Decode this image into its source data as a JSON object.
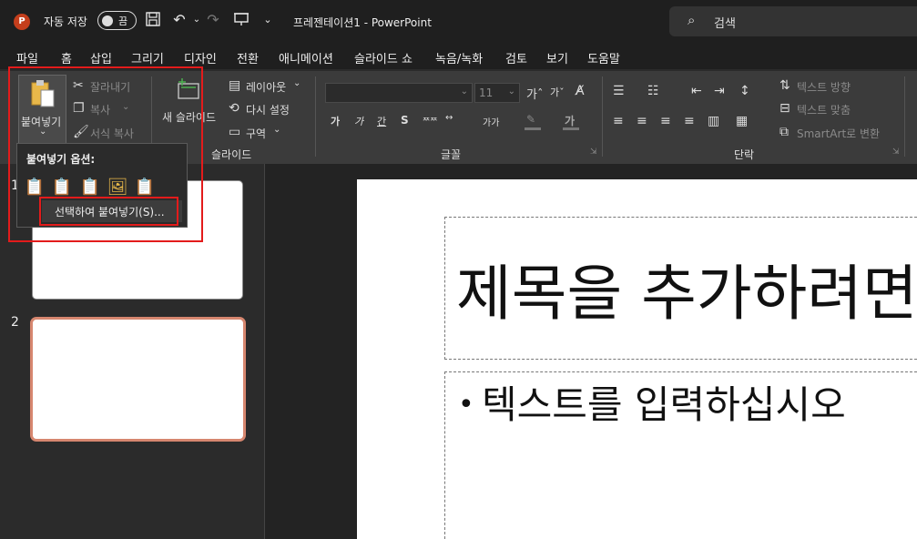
{
  "titlebar": {
    "app_logo": "P",
    "autosave_label": "자동 저장",
    "autosave_state": "끔",
    "doc_title": "프레젠테이션1 - PowerPoint",
    "search_placeholder": "검색",
    "icons": [
      "save-icon",
      "undo-icon",
      "redo-icon",
      "present-icon",
      "customize-qat-icon"
    ]
  },
  "menu": {
    "tabs": [
      "파일",
      "홈",
      "삽입",
      "그리기",
      "디자인",
      "전환",
      "애니메이션",
      "슬라이드 쇼",
      "녹음/녹화",
      "검토",
      "보기",
      "도움말"
    ]
  },
  "ribbon": {
    "clipboard": {
      "paste": "붙여넣기",
      "cut": "잘라내기",
      "copy": "복사",
      "format_painter": "서식 복사"
    },
    "slides": {
      "new_slide": "새 슬라이드",
      "layout": "레이아웃",
      "reset": "다시 설정",
      "section": "구역",
      "group_label": "슬라이드"
    },
    "font": {
      "font_size": "11",
      "group_label": "글꼴"
    },
    "paragraph": {
      "text_direction": "텍스트 방향",
      "align_text": "텍스트 맞춤",
      "smartart": "SmartArt로 변환",
      "group_label": "단락"
    }
  },
  "paste_menu": {
    "title": "붙여넣기 옵션:",
    "options": [
      "paste-keep-source-icon",
      "paste-use-destination-icon",
      "paste-embed-icon",
      "paste-picture-icon",
      "paste-keep-text-icon"
    ],
    "paste_special": "선택하여 붙여넣기(S)..."
  },
  "thumbnails": [
    {
      "number": "1"
    },
    {
      "number": "2"
    }
  ],
  "slide": {
    "title_placeholder": "제목을 추가하려면",
    "body_bullet": "•",
    "body_placeholder": "텍스트를 입력하십시오"
  },
  "colors": {
    "app_accent": "#c43e1c",
    "highlight_box": "#e31b1b",
    "selected_thumb_border": "#d6866f"
  }
}
